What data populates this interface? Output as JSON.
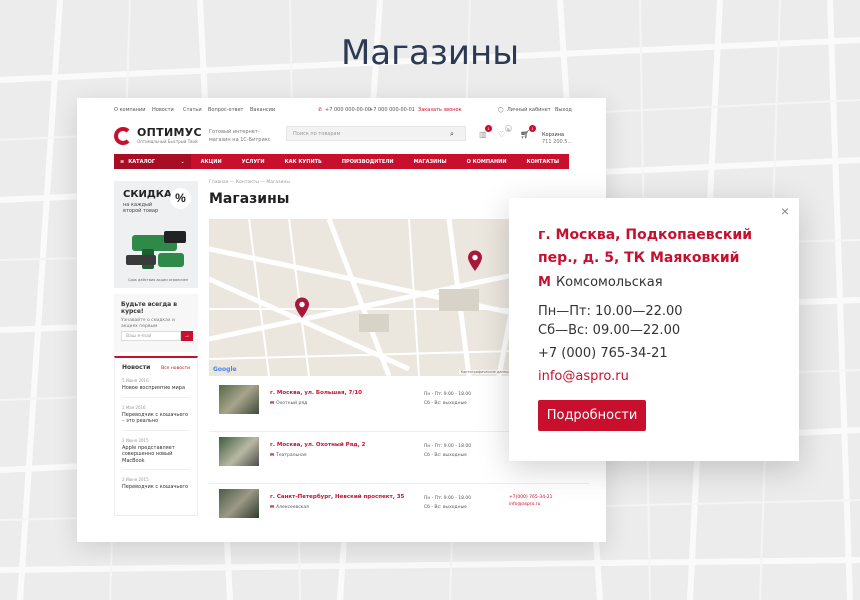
{
  "hero": {
    "title": "Магазины"
  },
  "topbar": {
    "links": [
      "О компании",
      "Новости",
      "Статьи",
      "Вопрос-ответ",
      "Вакансии"
    ],
    "phone1": "+7 000 000-00-00",
    "phone2": "+7 000 000-00-01",
    "callback": "Заказать звонок",
    "account": "Личный кабинет",
    "logout": "Выход"
  },
  "header": {
    "logo_name": "ОПТИМУС",
    "logo_tagline": "Оптимальный Быстрый Твой",
    "tagline": "Готовый интернет-магазин на 1С-Битрикс",
    "search_placeholder": "Поиск по товарам",
    "compare_badge": "1",
    "favorites_badge": "5",
    "cart_badge": "1",
    "cart_label": "Корзина",
    "cart_sum": "711 200.5..."
  },
  "nav": {
    "catalog": "КАТАЛОГ",
    "items": [
      "АКЦИИ",
      "УСЛУГИ",
      "КАК КУПИТЬ",
      "ПРОИЗВОДИТЕЛИ",
      "МАГАЗИНЫ",
      "О КОМПАНИИ",
      "КОНТАКТЫ"
    ]
  },
  "promo": {
    "title": "СКИДКА",
    "subtitle": "на каждый второй товар",
    "percent": "%",
    "footnote": "Срок действия акции ограничен"
  },
  "subscribe": {
    "title": "Будьте всегда в курсе!",
    "subtitle": "Узнавайте о скидках и акциях первым",
    "placeholder": "Ваш e-mail"
  },
  "news": {
    "title": "Новости",
    "all_label": "Все новости",
    "items": [
      {
        "date": "5 Июня 2016",
        "title": "Новое восприятие мира"
      },
      {
        "date": "1 Мая 2016",
        "title": "Переводчик с кошачьего – это реально"
      },
      {
        "date": "2 Июня 2015",
        "title": "Apple представляет совершенно новый MacBook"
      },
      {
        "date": "2 Июня 2015",
        "title": "Переводчик с кошачьего"
      }
    ]
  },
  "breadcrumb": {
    "home": "Главная",
    "contacts": "Контакты",
    "current": "Магазины"
  },
  "page": {
    "title": "Магазины"
  },
  "map": {
    "copyright": "Картографические данные © 2016 Google  Условия использования",
    "google": "Google"
  },
  "stores": [
    {
      "address": "г. Москва, ул. Большая, 7/10",
      "metro": "Охотный ряд",
      "weekday": "Пн - Пт: 9.00 - 18.00",
      "weekend": "Сб - Вс: выходные",
      "phone": "",
      "email": ""
    },
    {
      "address": "г. Москва, ул. Охотный Ряд, 2",
      "metro": "Театральная",
      "weekday": "Пн - Пт: 9.00 - 18.00",
      "weekend": "Сб - Вс: выходные",
      "phone": "",
      "email": ""
    },
    {
      "address": "г. Санкт-Петербург, Невский проспект, 35",
      "metro": "Алексеевская",
      "weekday": "Пн - Пт: 9.00 - 18.00",
      "weekend": "Сб - Вс: выходные",
      "phone": "+7(000) 765-34-21",
      "email": "info@aspro.ru"
    }
  ],
  "popup": {
    "address": "г. Москва, Подкопаевский пер., д. 5, ТК Маяковкий",
    "metro_icon": "М",
    "metro": "Комсомольская",
    "hours_weekday": "Пн—Пт: 10.00—22.00",
    "hours_weekend": "Сб—Вс: 09.00—22.00",
    "phone": "+7 (000) 765-34-21",
    "email": "info@aspro.ru",
    "button": "Подробности"
  },
  "colors": {
    "accent": "#c8102e",
    "title": "#2d3a55"
  }
}
